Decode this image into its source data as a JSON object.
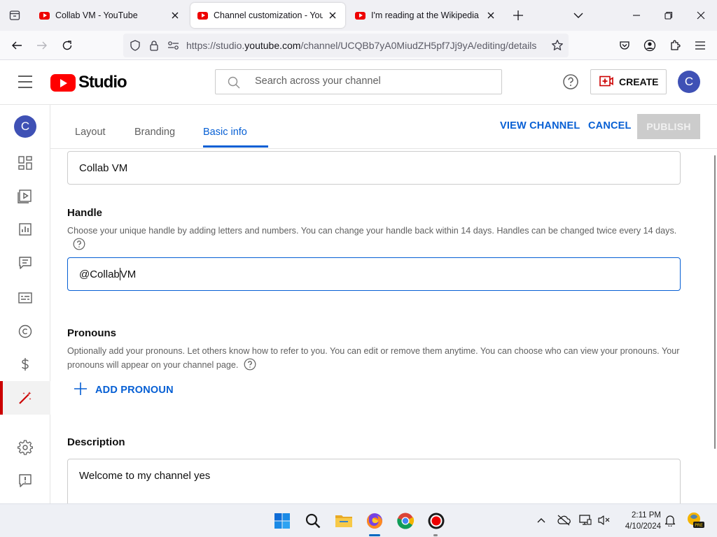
{
  "browser": {
    "tabs": [
      {
        "title": "Collab VM - YouTube",
        "active": false
      },
      {
        "title": "Channel customization - YouTube Studio",
        "active": true
      },
      {
        "title": "I'm reading at the Wikipedia - YouTube",
        "active": false
      }
    ],
    "url": {
      "scheme": "https://studio.",
      "host": "youtube.com",
      "path": "/channel/UCQBb7yA0MiudZH5pf7Jj9yA/editing/details"
    }
  },
  "studio": {
    "logo_text": "Studio",
    "search_placeholder": "Search across your channel",
    "create_label": "CREATE",
    "avatar_letter": "C",
    "brand_color": "#ff0000",
    "accent_color": "#065fd4"
  },
  "sidebar": {
    "avatar_letter": "C",
    "items": [
      {
        "icon": "dashboard-icon"
      },
      {
        "icon": "content-icon"
      },
      {
        "icon": "analytics-icon"
      },
      {
        "icon": "comments-icon"
      },
      {
        "icon": "subtitles-icon"
      },
      {
        "icon": "copyright-icon"
      },
      {
        "icon": "earn-icon"
      },
      {
        "icon": "customization-icon",
        "active": true
      },
      {
        "icon": "settings-icon"
      },
      {
        "icon": "feedback-icon"
      }
    ]
  },
  "content": {
    "tabs": [
      "Layout",
      "Branding",
      "Basic info"
    ],
    "active_tab": "Basic info",
    "view_channel": "VIEW CHANNEL",
    "cancel": "CANCEL",
    "publish": "PUBLISH"
  },
  "form": {
    "name_value": "Collab VM",
    "handle": {
      "title": "Handle",
      "description": "Choose your unique handle by adding letters and numbers. You can change your handle back within 14 days. Handles can be changed twice every 14 days.",
      "value_before_caret": "@Collab",
      "value_after_caret": "VM"
    },
    "pronouns": {
      "title": "Pronouns",
      "description": "Optionally add your pronouns. Let others know how to refer to you. You can edit or remove them anytime. You can choose who can view your pronouns. Your pronouns will appear on your channel page.",
      "add_label": "ADD PRONOUN"
    },
    "description": {
      "title": "Description",
      "value": "Welcome to my channel yes"
    }
  },
  "taskbar": {
    "time": "2:11 PM",
    "date": "4/10/2024"
  }
}
